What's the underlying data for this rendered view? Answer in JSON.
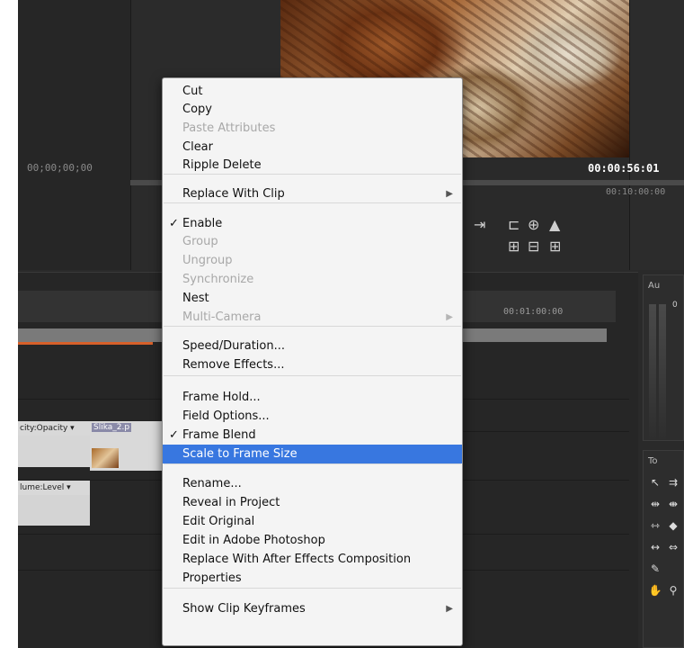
{
  "monitor": {
    "timecode_left": "00;00;00;00",
    "timecode_right": "00:00:56:01",
    "timecode_right_sub": "00:10:00:00"
  },
  "timeline": {
    "ruler_label": "00:01:00:00",
    "clip_opacity_label": "city:Opacity ▾",
    "clip_name": "Slika_2.p",
    "clip_volume_label": "lume:Level ▾"
  },
  "audio_panel": {
    "tab": "Au",
    "zero_label": "0"
  },
  "tools_panel": {
    "tab": "To"
  },
  "context_menu": {
    "items": [
      {
        "label": "Cut",
        "disabled": false,
        "checked": false,
        "submenu": false
      },
      {
        "label": "Copy",
        "disabled": false,
        "checked": false,
        "submenu": false
      },
      {
        "label": "Paste Attributes",
        "disabled": true,
        "checked": false,
        "submenu": false
      },
      {
        "label": "Clear",
        "disabled": false,
        "checked": false,
        "submenu": false
      },
      {
        "label": "Ripple Delete",
        "disabled": false,
        "checked": false,
        "submenu": false
      },
      {
        "label": "Replace With Clip",
        "disabled": false,
        "checked": false,
        "submenu": true
      },
      {
        "label": "Enable",
        "disabled": false,
        "checked": true,
        "submenu": false
      },
      {
        "label": "Group",
        "disabled": true,
        "checked": false,
        "submenu": false
      },
      {
        "label": "Ungroup",
        "disabled": true,
        "checked": false,
        "submenu": false
      },
      {
        "label": "Synchronize",
        "disabled": true,
        "checked": false,
        "submenu": false
      },
      {
        "label": "Nest",
        "disabled": false,
        "checked": false,
        "submenu": false
      },
      {
        "label": "Multi-Camera",
        "disabled": true,
        "checked": false,
        "submenu": true
      },
      {
        "label": "Speed/Duration...",
        "disabled": false,
        "checked": false,
        "submenu": false
      },
      {
        "label": "Remove Effects...",
        "disabled": false,
        "checked": false,
        "submenu": false
      },
      {
        "label": "Frame Hold...",
        "disabled": false,
        "checked": false,
        "submenu": false
      },
      {
        "label": "Field Options...",
        "disabled": false,
        "checked": false,
        "submenu": false
      },
      {
        "label": "Frame Blend",
        "disabled": false,
        "checked": true,
        "submenu": false
      },
      {
        "label": "Scale to Frame Size",
        "disabled": false,
        "checked": false,
        "submenu": false,
        "highlighted": true
      },
      {
        "label": "Rename...",
        "disabled": false,
        "checked": false,
        "submenu": false
      },
      {
        "label": "Reveal in Project",
        "disabled": false,
        "checked": false,
        "submenu": false
      },
      {
        "label": "Edit Original",
        "disabled": false,
        "checked": false,
        "submenu": false
      },
      {
        "label": "Edit in Adobe Photoshop",
        "disabled": false,
        "checked": false,
        "submenu": false
      },
      {
        "label": "Replace With After Effects Composition",
        "disabled": false,
        "checked": false,
        "submenu": false
      },
      {
        "label": "Properties",
        "disabled": false,
        "checked": false,
        "submenu": false
      },
      {
        "label": "Show Clip Keyframes",
        "disabled": false,
        "checked": false,
        "submenu": true
      }
    ],
    "check_glyph": "✓",
    "submenu_glyph": "▶",
    "highlight_color": "#3877e0"
  }
}
